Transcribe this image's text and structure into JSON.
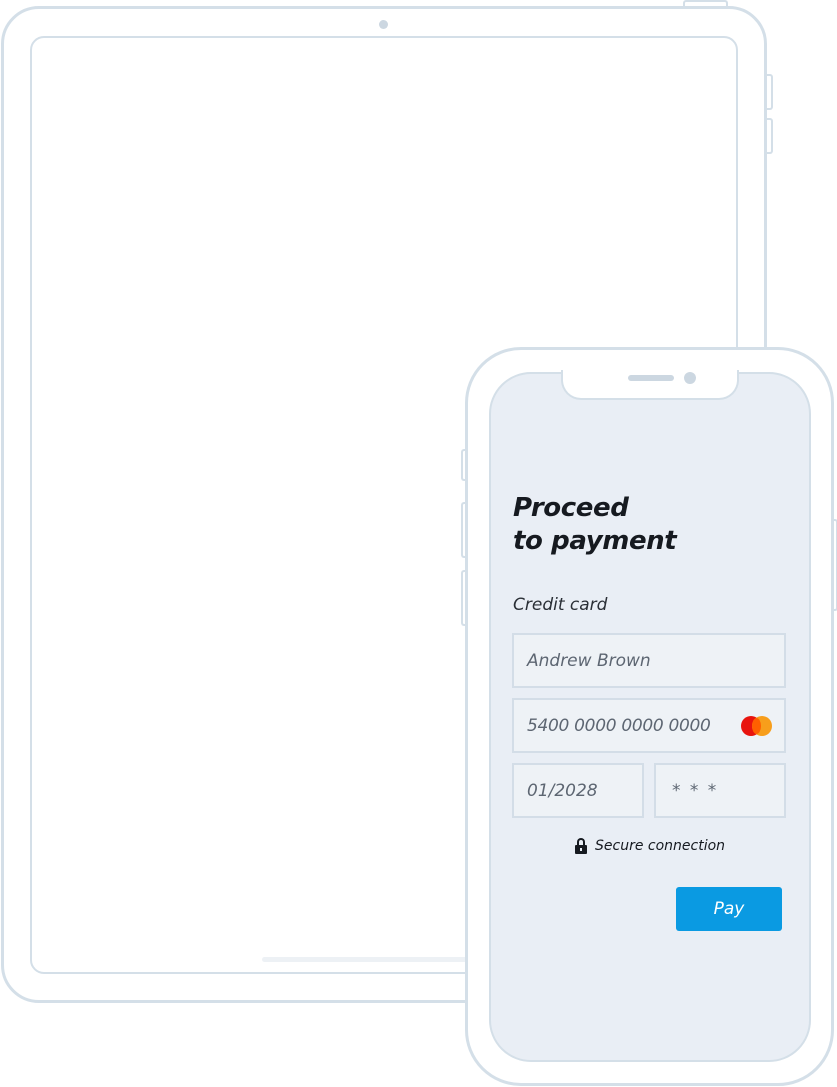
{
  "payment": {
    "title_line1": "Proceed",
    "title_line2": "to payment",
    "section_label": "Credit card",
    "cardholder_name": "Andrew Brown",
    "card_number": "5400 0000 0000 0000",
    "expiry": "01/2028",
    "cvv": "* * *",
    "card_brand_icon": "mastercard-logo",
    "secure_icon": "lock-icon",
    "secure_text": "Secure connection",
    "pay_label": "Pay"
  },
  "colors": {
    "accent": "#0a9ae2",
    "device_outline": "#d4dfe8",
    "phone_screen_bg": "#e9eef5",
    "field_bg": "#eef2f6",
    "mastercard_red": "#e8140e",
    "mastercard_orange": "#f79e1b"
  }
}
